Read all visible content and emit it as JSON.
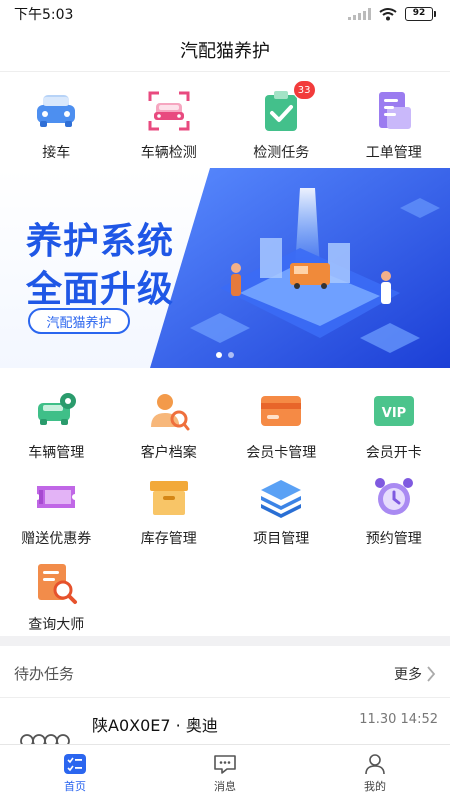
{
  "status_bar": {
    "time": "下午5:03",
    "battery": "92"
  },
  "app_title": "汽配猫养护",
  "top_menu": [
    {
      "label": "接车",
      "icon": "car-front-icon"
    },
    {
      "label": "车辆检测",
      "icon": "car-scan-icon"
    },
    {
      "label": "检测任务",
      "icon": "clipboard-check-icon",
      "badge": "33"
    },
    {
      "label": "工单管理",
      "icon": "document-list-icon"
    }
  ],
  "banner": {
    "line1": "养护系统",
    "line2": "全面升级",
    "tag": "汽配猫养护"
  },
  "grid_menu": [
    {
      "label": "车辆管理",
      "icon": "car-gear-icon"
    },
    {
      "label": "客户档案",
      "icon": "customer-search-icon"
    },
    {
      "label": "会员卡管理",
      "icon": "card-icon"
    },
    {
      "label": "会员开卡",
      "icon": "vip-icon",
      "icon_text": "VIP"
    },
    {
      "label": "赠送优惠券",
      "icon": "coupon-icon"
    },
    {
      "label": "库存管理",
      "icon": "box-icon"
    },
    {
      "label": "项目管理",
      "icon": "layers-icon"
    },
    {
      "label": "预约管理",
      "icon": "alarm-clock-icon"
    },
    {
      "label": "查询大师",
      "icon": "search-doc-icon"
    }
  ],
  "todo": {
    "title": "待办任务",
    "more": "更多",
    "items": [
      {
        "plate": "陕A0X0E7 · 奥迪",
        "time": "11.30 14:52",
        "logo": "audi-logo"
      }
    ]
  },
  "tabs": [
    {
      "label": "首页",
      "icon": "home-icon",
      "active": true
    },
    {
      "label": "消息",
      "icon": "message-icon",
      "active": false
    },
    {
      "label": "我的",
      "icon": "profile-icon",
      "active": false
    }
  ],
  "colors": {
    "accent": "#2b66ef",
    "badge": "#f23b3b",
    "banner_blue": "#1f57e6"
  }
}
